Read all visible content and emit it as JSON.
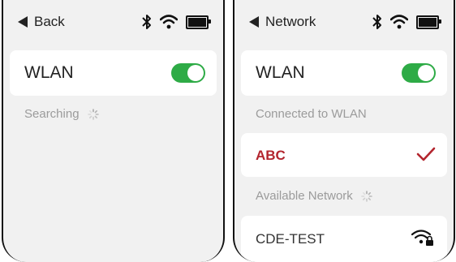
{
  "left_screen": {
    "back_label": "Back",
    "wlan_label": "WLAN",
    "wlan_toggle": "on",
    "searching_label": "Searching"
  },
  "right_screen": {
    "back_label": "Network",
    "wlan_label": "WLAN",
    "wlan_toggle": "on",
    "connected_section": "Connected to WLAN",
    "connected_network": "ABC",
    "available_section": "Available Network",
    "available_networks": [
      {
        "name": "CDE-TEST",
        "secured": true
      }
    ]
  },
  "colors": {
    "toggle_on": "#2eab46",
    "connected_accent": "#b3252e",
    "background": "#f1f1f1",
    "muted_text": "#9b9b9b"
  },
  "icons": [
    "back-arrow-icon",
    "bluetooth-icon",
    "wifi-icon",
    "battery-icon",
    "spinner-icon",
    "checkmark-icon",
    "wifi-lock-icon"
  ]
}
